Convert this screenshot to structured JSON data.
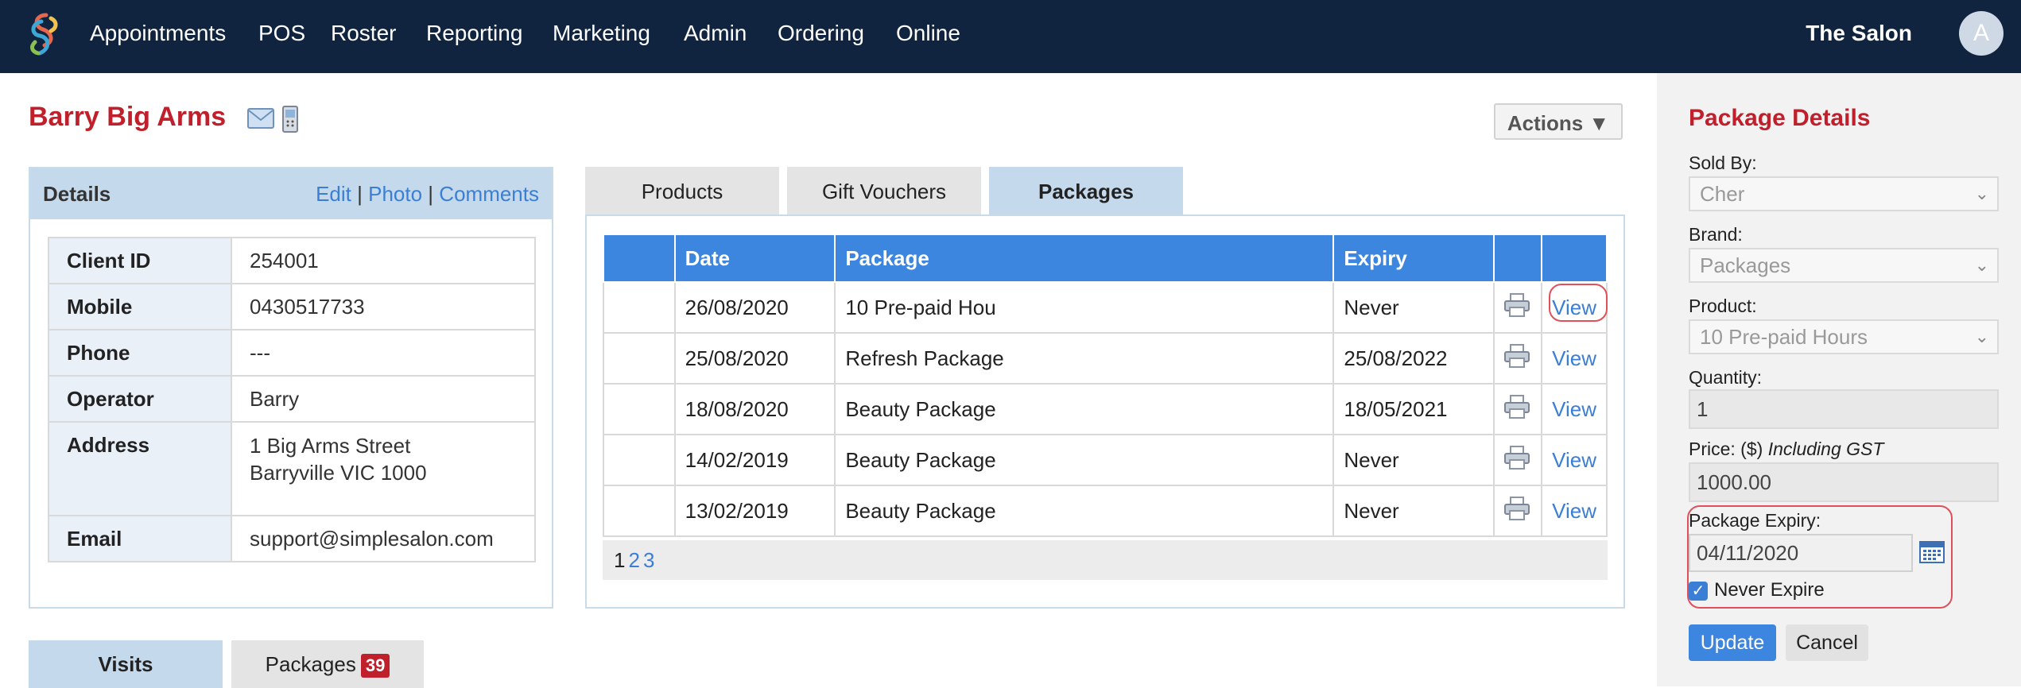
{
  "nav": {
    "items": [
      "Appointments",
      "POS",
      "Roster",
      "Reporting",
      "Marketing",
      "Admin",
      "Ordering",
      "Online"
    ],
    "salon_name": "The Salon",
    "avatar_initial": "A"
  },
  "client": {
    "name": "Barry Big Arms",
    "actions_label": "Actions ▼"
  },
  "details": {
    "title": "Details",
    "links": {
      "edit": "Edit",
      "photo": "Photo",
      "comments": "Comments",
      "separator": "|"
    },
    "rows": [
      {
        "label": "Client ID",
        "value": "254001"
      },
      {
        "label": "Mobile",
        "value": "0430517733"
      },
      {
        "label": "Phone",
        "value": "---"
      },
      {
        "label": "Operator",
        "value": "Barry"
      },
      {
        "label": "Address",
        "value": "1 Big Arms Street",
        "value2": "Barryville VIC 1000"
      },
      {
        "label": "Email",
        "value": "support@simplesalon.com"
      }
    ]
  },
  "bottom_tabs": {
    "visits": "Visits",
    "packages": "Packages",
    "packages_count": "39"
  },
  "product_tabs": [
    "Products",
    "Gift Vouchers",
    "Packages"
  ],
  "packages_table": {
    "headers": [
      "",
      "Date",
      "Package",
      "Expiry",
      "",
      ""
    ],
    "rows": [
      {
        "date": "26/08/2020",
        "package": "10 Pre-paid Hou",
        "expiry": "Never",
        "action": "View"
      },
      {
        "date": "25/08/2020",
        "package": "Refresh Package",
        "expiry": "25/08/2022",
        "action": "View"
      },
      {
        "date": "18/08/2020",
        "package": "Beauty Package",
        "expiry": "18/05/2021",
        "action": "View"
      },
      {
        "date": "14/02/2019",
        "package": "Beauty Package",
        "expiry": "Never",
        "action": "View"
      },
      {
        "date": "13/02/2019",
        "package": "Beauty Package",
        "expiry": "Never",
        "action": "View"
      }
    ],
    "pages": [
      "1",
      "2",
      "3"
    ]
  },
  "package_details": {
    "title": "Package Details",
    "sold_by_label": "Sold By:",
    "sold_by_value": "Cher",
    "brand_label": "Brand:",
    "brand_value": "Packages",
    "product_label": "Product:",
    "product_value": "10 Pre-paid Hours",
    "quantity_label": "Quantity:",
    "quantity_value": "1",
    "price_label": "Price: ($)",
    "price_note": "Including GST",
    "price_value": "1000.00",
    "expiry_label": "Package Expiry:",
    "expiry_value": "04/11/2020",
    "never_expire_label": "Never Expire",
    "never_expire_checked": true,
    "update_label": "Update",
    "cancel_label": "Cancel"
  },
  "colors": {
    "topbar": "#10243f",
    "accent_red": "#c0202b",
    "link_blue": "#3a7fd5",
    "header_blue": "#3d86e0",
    "highlight_ring": "#e0505a"
  }
}
